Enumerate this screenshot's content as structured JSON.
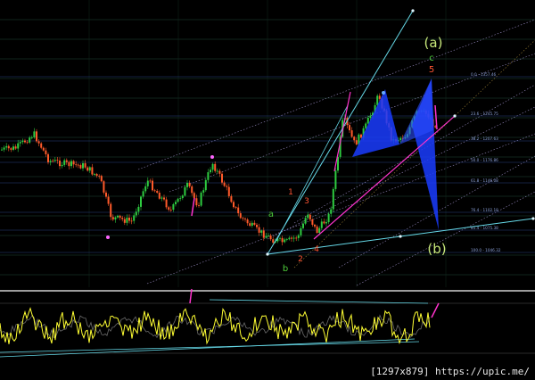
{
  "watermark": "[1297x879] https://upic.me/",
  "chart_data": {
    "type": "candlestick",
    "colors": {
      "background": "#000000",
      "grid": "#1f4a3a",
      "up_candle": "#2ecc40",
      "down_candle": "#ff5a2a",
      "trendline": "#66d9e8",
      "channel": "#c8b7ff",
      "pattern": "#1a3cff",
      "wave_pink": "#ff33cc",
      "oscillator": "#ffff33"
    },
    "fib_levels": [
      {
        "label": "0.0 - 1357.46"
      },
      {
        "label": "23.6 - 1245.75"
      },
      {
        "label": "38.2 - 1207.63"
      },
      {
        "label": "50.0 - 1176.86"
      },
      {
        "label": "61.8 - 1146.08"
      },
      {
        "label": "76.4 - 1102.18"
      },
      {
        "label": "85.4 - 1075.38"
      },
      {
        "label": "100.0 - 1046.32"
      }
    ],
    "wave_labels": {
      "a_paren": "(a)",
      "c": "c",
      "five": "5",
      "b_paren": "(b)",
      "a": "a",
      "b": "b",
      "one": "1",
      "two": "2",
      "three": "3",
      "four": "4"
    }
  }
}
